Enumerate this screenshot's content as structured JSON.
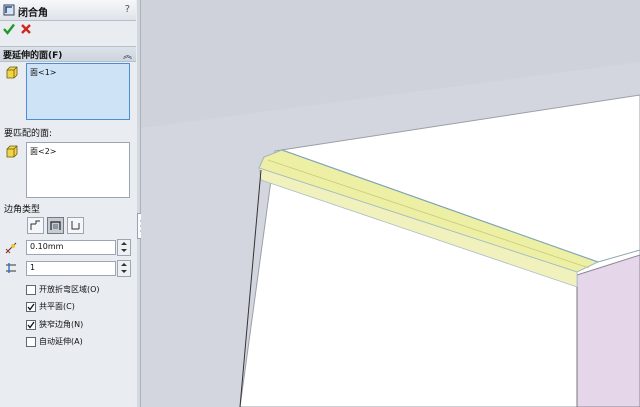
{
  "panel": {
    "title": "闭合角",
    "help_label": "?",
    "faces_to_extend": {
      "header": "要延伸的面(F)",
      "items": [
        "面<1>"
      ]
    },
    "faces_to_match": {
      "label": "要匹配的面:",
      "items": [
        "面<2>"
      ]
    },
    "corner_type": {
      "label": "边角类型",
      "options": [
        "butt-corner-icon",
        "overlap-corner-icon",
        "underlap-corner-icon"
      ],
      "selected": 1
    },
    "gap_distance": "0.10mm",
    "overlap_ratio": "1",
    "options": [
      {
        "label": "开放折弯区域(O)",
        "checked": false
      },
      {
        "label": "共平面(C)",
        "checked": true
      },
      {
        "label": "狭窄边角(N)",
        "checked": true
      },
      {
        "label": "自动延伸(A)",
        "checked": false
      }
    ]
  },
  "colors": {
    "viewport_background": "#d3d6df",
    "highlight_face": "#ecefa4",
    "side_face": "#e5d6ea",
    "selection_box": "#cfe3f7"
  }
}
